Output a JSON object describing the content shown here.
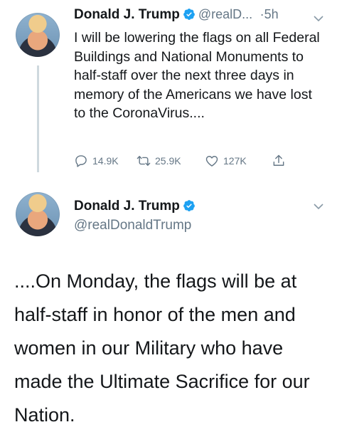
{
  "tweet1": {
    "name": "Donald J. Trump",
    "handle": "@realD...",
    "separator": "·",
    "time": "5h",
    "text": "I will be lowering the flags on all Federal Buildings and National Monuments to half-staff over the next three days in memory of the Americans we have lost to the CoronaVirus....",
    "replies": "14.9K",
    "retweets": "25.9K",
    "likes": "127K"
  },
  "tweet2": {
    "name": "Donald J. Trump",
    "handle": "@realDonaldTrump",
    "text": "....On Monday, the flags will be at half-staff in honor of the men and women in our Military who have made the Ultimate Sacrifice for our Nation."
  },
  "colors": {
    "verified": "#1da1f2",
    "text": "#14171a",
    "muted": "#657786",
    "thread_line": "#cfd9de"
  },
  "icons": {
    "reply": "reply-icon",
    "retweet": "retweet-icon",
    "like": "heart-icon",
    "share": "share-icon",
    "menu": "chevron-down-icon",
    "verified": "verified-badge-icon"
  }
}
